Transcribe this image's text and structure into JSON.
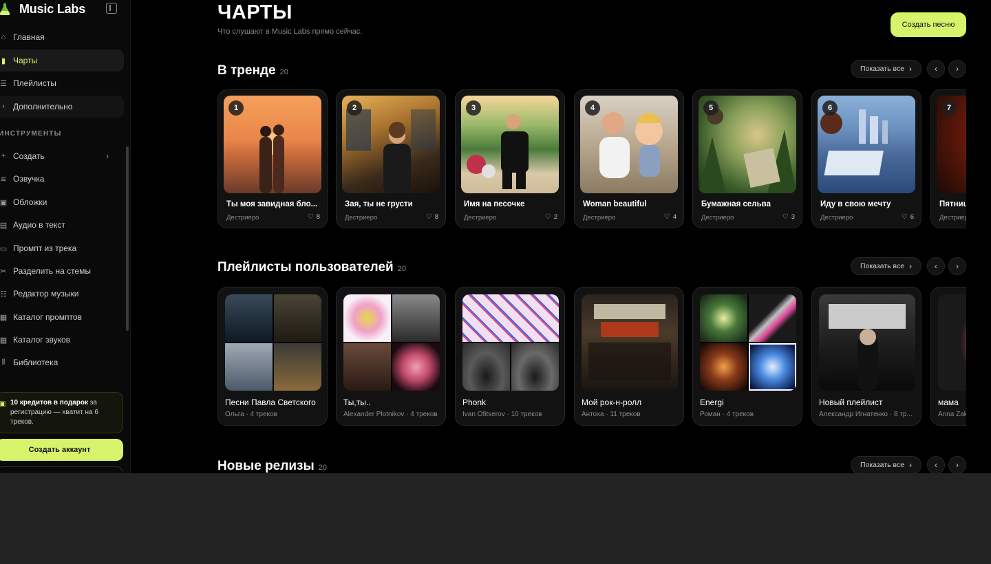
{
  "brand": {
    "name": "Music Labs"
  },
  "nav": {
    "main": [
      {
        "label": "Главная",
        "icon": "home-icon"
      },
      {
        "label": "Чарты",
        "icon": "chart-icon",
        "active": true
      },
      {
        "label": "Плейлисты",
        "icon": "playlist-icon"
      },
      {
        "label": "Дополнительно",
        "icon": "chevron-right-icon"
      }
    ],
    "tools_label": "ИНСТРУМЕНТЫ",
    "tools": [
      {
        "label": "Создать",
        "icon": "plus-icon",
        "chevron": "›"
      },
      {
        "label": "Озвучка",
        "icon": "waveform-icon"
      },
      {
        "label": "Обложки",
        "icon": "image-icon"
      },
      {
        "label": "Аудио в текст",
        "icon": "text-icon"
      },
      {
        "label": "Промпт из трека",
        "icon": "prompt-icon"
      },
      {
        "label": "Разделить на стемы",
        "icon": "scissors-icon"
      },
      {
        "label": "Редактор музыки",
        "icon": "sliders-icon"
      },
      {
        "label": "Каталог промптов",
        "icon": "catalog-icon"
      },
      {
        "label": "Каталог звуков",
        "icon": "sound-catalog-icon"
      },
      {
        "label": "Библиотека",
        "icon": "library-icon"
      }
    ]
  },
  "promo": {
    "bold": "10 кредитов в подарок",
    "rest": " за регистрацию — хватит на 6 треков."
  },
  "create_account": "Создать аккаунт",
  "header": {
    "title": "ЧАРТЫ",
    "subtitle": "Что слушают в Music Labs прямо сейчас.",
    "create_song": "Создать песню"
  },
  "show_all": "Показать все",
  "arrows": {
    "prev": "‹",
    "next": "›"
  },
  "trending": {
    "title": "В тренде",
    "count": "20",
    "items": [
      {
        "rank": "1",
        "title": "Ты моя завидная бло...",
        "author": "Дестриеро",
        "likes": "8"
      },
      {
        "rank": "2",
        "title": "Зая, ты не грусти",
        "author": "Дестриеро",
        "likes": "8"
      },
      {
        "rank": "3",
        "title": "Имя на песочке",
        "author": "Дестриеро",
        "likes": "2"
      },
      {
        "rank": "4",
        "title": "Woman beautiful",
        "author": "Дестриеро",
        "likes": "4"
      },
      {
        "rank": "5",
        "title": "Бумажная сельва",
        "author": "Дестриеро",
        "likes": "3"
      },
      {
        "rank": "6",
        "title": "Иду в свою мечту",
        "author": "Дестриеро",
        "likes": "6"
      },
      {
        "rank": "7",
        "title": "Пятница",
        "author": "Дестриеро",
        "likes": ""
      }
    ]
  },
  "playlists": {
    "title": "Плейлисты пользователей",
    "count": "20",
    "items": [
      {
        "title": "Песни Павла Светского",
        "meta": "Ольга · 4 треков"
      },
      {
        "title": "Ты,ты..",
        "meta": "Alexander Plotnikov · 4 треков"
      },
      {
        "title": "Phonk",
        "meta": "Ivan Ofitserov · 10 треков"
      },
      {
        "title": "Мой рок-н-ролл",
        "meta": "Антоха · 11 треков"
      },
      {
        "title": "Energi",
        "meta": "Роман · 4 треков"
      },
      {
        "title": "Новый плейлист",
        "meta": "Александр Игнатенко · 8 тр..."
      },
      {
        "title": "мама",
        "meta": "Anna Zak"
      }
    ]
  },
  "new_releases": {
    "title": "Новые релизы",
    "count": "20"
  }
}
